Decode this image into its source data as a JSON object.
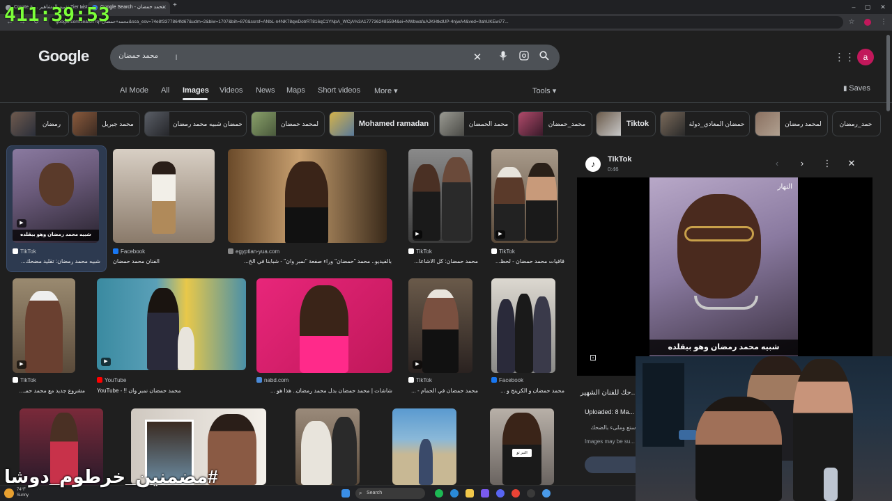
{
  "overlay": {
    "timer": "411:39:53",
    "watermark": "#مضمنين_خرطوم_دوشا"
  },
  "browser": {
    "tabs": [
      {
        "label": "Create a ... تقييم المشاهير Tier List"
      },
      {
        "label": "Google Search - محمد حمضان"
      }
    ],
    "new_tab": "+",
    "url": "google.com/search?q=محمد+حمضان&sca_esv=74e8f3377864fd67&udm=2&biw=1707&bih=870&ssrsf=ANbL-n4NK78qwDotrRT816qC1YNpA_WCjA%3A1777362485594&ei=NWbwafuAJKHtkdUP-4njwA4&ved=0ahUKEwi77...",
    "controls": {
      "minimize": "–",
      "maximize": "▢",
      "close": "✕"
    }
  },
  "google": {
    "logo": "Google",
    "search": {
      "value": "محمد حمضان"
    },
    "nav": [
      "AI Mode",
      "All",
      "Images",
      "Videos",
      "News",
      "Maps",
      "Short videos",
      "More ▾"
    ],
    "tools": "Tools ▾",
    "saves": "Saves",
    "avatar": "a"
  },
  "chips": [
    {
      "label": "رمضان"
    },
    {
      "label": "محمد جبريل"
    },
    {
      "label": "حمضان شبيه محمد رمضان"
    },
    {
      "label": "لمحمد حمضان"
    },
    {
      "label": "Mohamed ramadan"
    },
    {
      "label": "محمد الحمضان"
    },
    {
      "label": "محمد_حمضان"
    },
    {
      "label": "Tiktok"
    },
    {
      "label": "حمضان المعادي_دولة"
    },
    {
      "label": "لمحمد رمضان"
    },
    {
      "label": "حمد_رمضان"
    }
  ],
  "results": [
    {
      "source": "TikTok",
      "caption": "شبيه محمد رمضان: تقليد مضحك..."
    },
    {
      "source": "Facebook",
      "caption": "الفنان محمد حمضان"
    },
    {
      "source": "egyptian-yua.com",
      "caption": "بالفيديو.. محمد \"حمضان\" وراء صفعة \"نمبر وان\" - شبابنا في الخ..."
    },
    {
      "source": "TikTok",
      "caption": "محمد حمضان: كل الاشاعا..."
    },
    {
      "source": "TikTok",
      "caption": "قافيات محمد حمضان - لحظ..."
    },
    {
      "source": "TikTok",
      "caption": "مشروع جديد مع محمد حمـ..."
    },
    {
      "source": "YouTube",
      "caption": "YouTube - !! محمد حمضان نمبر وان"
    },
    {
      "source": "nabd.com",
      "caption": "شاشات | محمد حمضان بدل محمد رمضان.. هذا هو ..."
    },
    {
      "source": "TikTok",
      "caption": "محمد حمضان في الحمام - ..."
    },
    {
      "source": "Facebook",
      "caption": "محمد حمضان و الكرينج و ..."
    }
  ],
  "overlay_texts": {
    "thumb1": "شبيه محمد رمضان وهو بيقلده",
    "thumb_sticker": "النبر تو"
  },
  "panel": {
    "source": "TikTok",
    "duration": "0:46",
    "video_caption": "شبيه محمد رمضان وهو بيقلده",
    "channel_tag": "النهار",
    "title": "...حك للفنان الشهير",
    "uploaded": "Uploaded: 8 Ma...",
    "desc": "...ستع وملىء بالضحك",
    "note": "Images may be su..."
  },
  "taskbar": {
    "search": "Search",
    "temp": "74°F",
    "weather": "Sunny"
  }
}
